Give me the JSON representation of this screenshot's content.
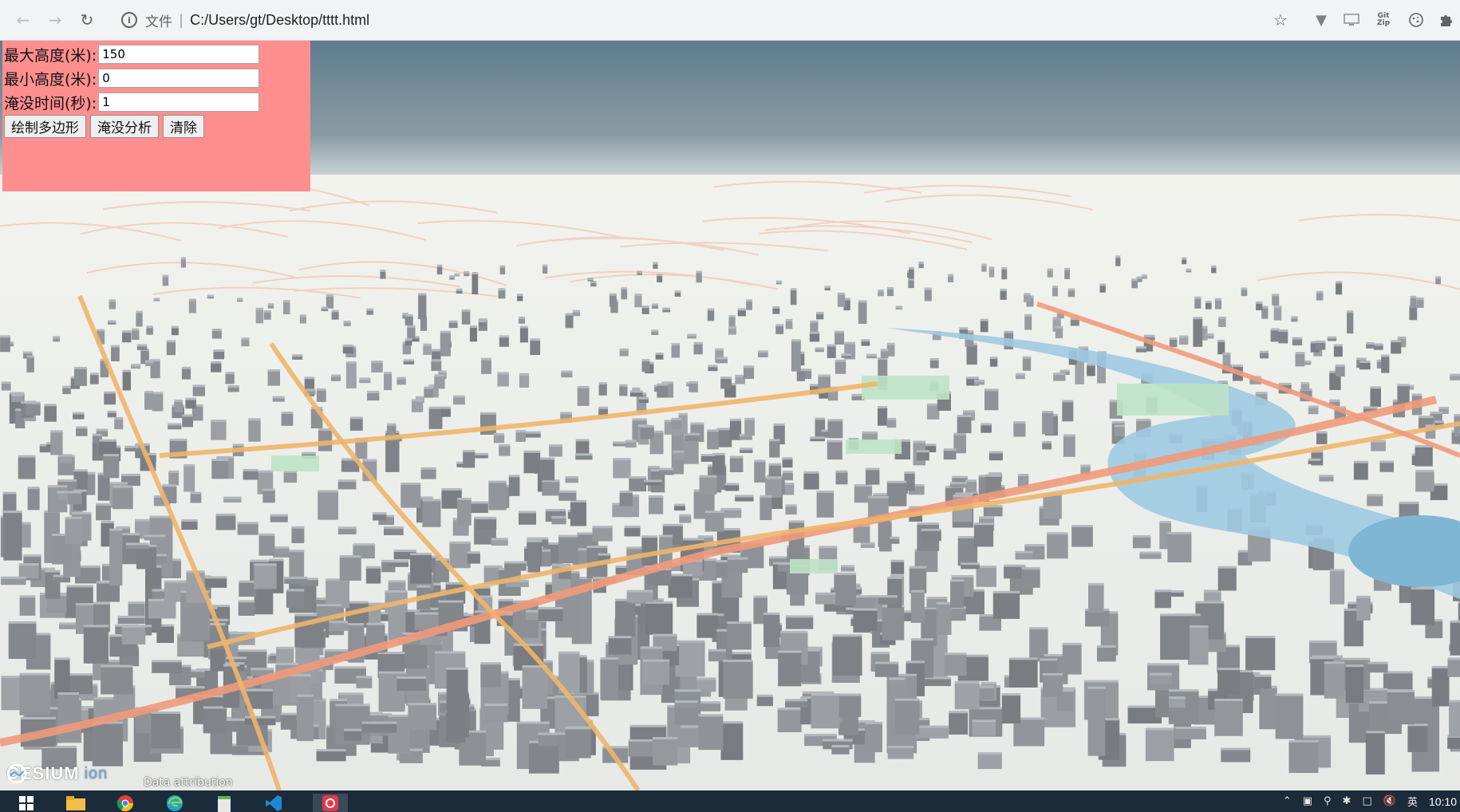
{
  "browser": {
    "address_prefix": "文件",
    "separator": "|",
    "url": "C:/Users/gt/Desktop/tttt.html",
    "icons": [
      "back-arrow-icon",
      "forward-arrow-icon",
      "reload-icon",
      "info-icon",
      "star-icon",
      "extension-v-icon",
      "screen-icon",
      "gitzip-icon",
      "cookie-icon",
      "puzzle-icon"
    ],
    "gitzip_label": [
      "Git",
      "Zip"
    ]
  },
  "panel": {
    "max_height_label": "最大高度(米):",
    "max_height_value": "150",
    "min_height_label": "最小高度(米):",
    "min_height_value": "0",
    "flood_time_label": "淹没时间(秒):",
    "flood_time_value": "1",
    "draw_polygon_label": "绘制多边形",
    "flood_analysis_label": "淹没分析",
    "clear_label": "清除",
    "background_color": "#ff8f8f"
  },
  "viewer": {
    "logo_text": "CESIUM",
    "logo_suffix": "ion",
    "attribution": "Data attribution",
    "sky_color_top": "#5e7c8f",
    "sky_color_horizon": "#c9d4d6",
    "ground_color": "#ecefec",
    "road_color": "#f0b56a",
    "water_color": "#9ecae1",
    "building_color": "#8c9196"
  },
  "taskbar": {
    "apps": [
      "windows-start-icon",
      "file-explorer-icon",
      "chrome-icon",
      "edge-icon",
      "notepad-icon",
      "vscode-icon",
      "app-icon"
    ],
    "tray_lang": "英",
    "clock": "10:10"
  }
}
